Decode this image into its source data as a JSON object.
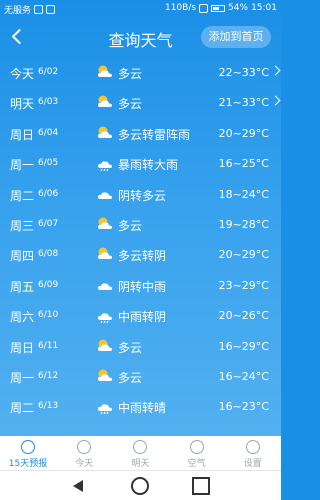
{
  "status": {
    "left_text": "无服务",
    "speed": "110B/s",
    "battery": "54%",
    "time": "15:01"
  },
  "header": {
    "title": "查询天气",
    "add_button": "添加到首页"
  },
  "forecast": [
    {
      "day": "今天",
      "date": "6/02",
      "icon": "partly-cloudy-icon",
      "desc": "多云",
      "temp": "22~33°C",
      "has_chevron": true
    },
    {
      "day": "明天",
      "date": "6/03",
      "icon": "partly-cloudy-icon",
      "desc": "多云",
      "temp": "21~33°C",
      "has_chevron": true
    },
    {
      "day": "周日",
      "date": "6/04",
      "icon": "partly-cloudy-icon",
      "desc": "多云转雷阵雨",
      "temp": "20~29°C"
    },
    {
      "day": "周一",
      "date": "6/05",
      "icon": "rain-icon",
      "desc": "暴雨转大雨",
      "temp": "16~25°C"
    },
    {
      "day": "周二",
      "date": "6/06",
      "icon": "cloudy-icon",
      "desc": "阴转多云",
      "temp": "18~24°C"
    },
    {
      "day": "周三",
      "date": "6/07",
      "icon": "partly-cloudy-icon",
      "desc": "多云",
      "temp": "19~28°C"
    },
    {
      "day": "周四",
      "date": "6/08",
      "icon": "partly-cloudy-icon",
      "desc": "多云转阴",
      "temp": "20~29°C"
    },
    {
      "day": "周五",
      "date": "6/09",
      "icon": "cloudy-icon",
      "desc": "阴转中雨",
      "temp": "23~29°C"
    },
    {
      "day": "周六",
      "date": "6/10",
      "icon": "rain-icon",
      "desc": "中雨转阴",
      "temp": "20~26°C"
    },
    {
      "day": "周日",
      "date": "6/11",
      "icon": "partly-cloudy-icon",
      "desc": "多云",
      "temp": "16~29°C"
    },
    {
      "day": "周一",
      "date": "6/12",
      "icon": "partly-cloudy-icon",
      "desc": "多云",
      "temp": "16~24°C"
    },
    {
      "day": "周二",
      "date": "6/13",
      "icon": "rain-icon",
      "desc": "中雨转晴",
      "temp": "16~23°C"
    }
  ],
  "tabs": [
    {
      "label": "15天预报",
      "icon": "forecast-icon",
      "active": true
    },
    {
      "label": "今天",
      "icon": "today-icon",
      "active": false
    },
    {
      "label": "明天",
      "icon": "tomorrow-icon",
      "active": false
    },
    {
      "label": "空气",
      "icon": "air-icon",
      "active": false
    },
    {
      "label": "设置",
      "icon": "settings-icon",
      "active": false
    }
  ],
  "colors": {
    "accent": "#1a8fe6",
    "sun": "#f6c430",
    "cloud": "#ffffff"
  }
}
